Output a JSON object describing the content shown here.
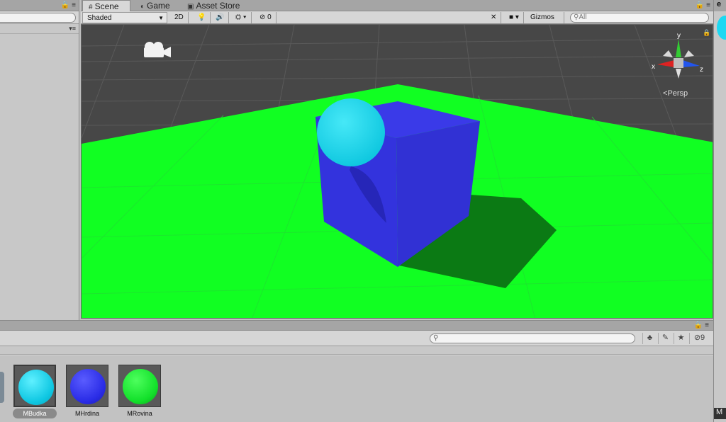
{
  "scene_tabs": [
    {
      "icon": "#",
      "label": "Scene"
    },
    {
      "icon": "◐",
      "label": "Game"
    },
    {
      "icon": "▣",
      "label": "Asset Store"
    }
  ],
  "scene_toolbar": {
    "shading_mode": "Shaded",
    "mode_2d": "2D",
    "hidden_count": "0",
    "gizmos_label": "Gizmos",
    "search_placeholder": "All"
  },
  "viewport": {
    "projection_label": "Persp",
    "gizmo_axes": {
      "x": "x",
      "y": "y",
      "z": "z"
    },
    "colors": {
      "sky": "#474747",
      "ground_plane": "#11ff22",
      "cube": "#3333dd",
      "sphere": "#1ad8ee"
    }
  },
  "project_panel": {
    "search_value": "",
    "hidden_count": "9",
    "assets": [
      {
        "name": "MBudka",
        "color": "#1ed8f2",
        "selected": true
      },
      {
        "name": "MHrdina",
        "color": "#2a2ce6",
        "selected": false
      },
      {
        "name": "MRovina",
        "color": "#12e02a",
        "selected": false
      }
    ]
  },
  "right_panel": {
    "top_label": "e",
    "bottom_label": "M"
  }
}
